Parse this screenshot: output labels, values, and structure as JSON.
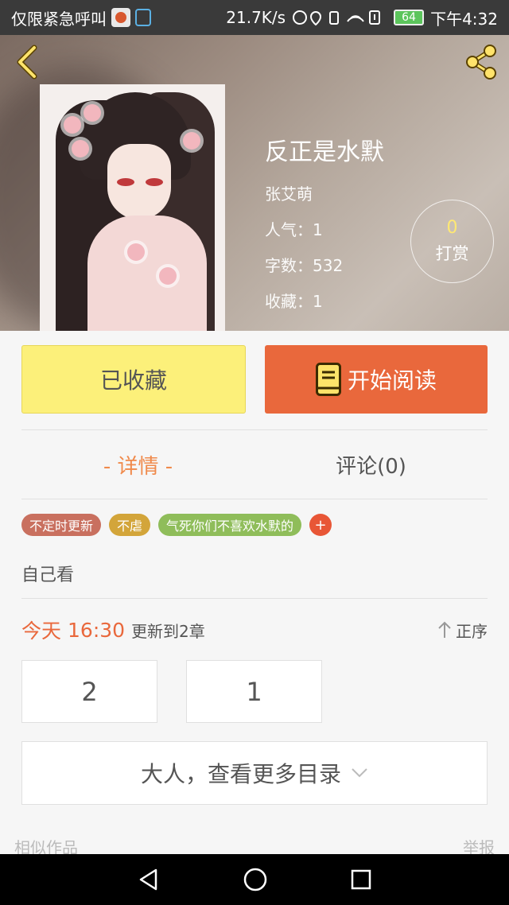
{
  "status_bar": {
    "left_text": "仅限紧急呼叫",
    "network_speed": "21.7K/s",
    "battery": "64",
    "time": "下午4:32"
  },
  "book": {
    "title": "反正是水默",
    "author": "张艾萌",
    "popularity": "人气：1",
    "word_count": "字数：532",
    "favorites": "收藏：1"
  },
  "reward": {
    "count": "0",
    "label": "打赏"
  },
  "actions": {
    "collected_label": "已收藏",
    "read_label": "开始阅读"
  },
  "tabs": [
    {
      "label": "- 详情 -"
    },
    {
      "label": "评论(0)"
    }
  ],
  "tags": [
    {
      "label": "不定时更新",
      "color": "#c9705f"
    },
    {
      "label": "不虐",
      "color": "#d3a53a"
    },
    {
      "label": "气死你们不喜欢水默的",
      "color": "#8fbd5a"
    }
  ],
  "tag_add": "+",
  "description": "自己看",
  "update": {
    "day": "今天",
    "time": "16:30",
    "text": "更新到2章",
    "sort_label": "正序"
  },
  "chapters": [
    "2",
    "1"
  ],
  "more_catalog": "大人，查看更多目录",
  "similar": {
    "label": "相似作品",
    "report": "举报"
  },
  "colors": {
    "accent_orange": "#e9683c",
    "collect_yellow": "#fcf07a",
    "active_tab": "#f08a4b"
  }
}
